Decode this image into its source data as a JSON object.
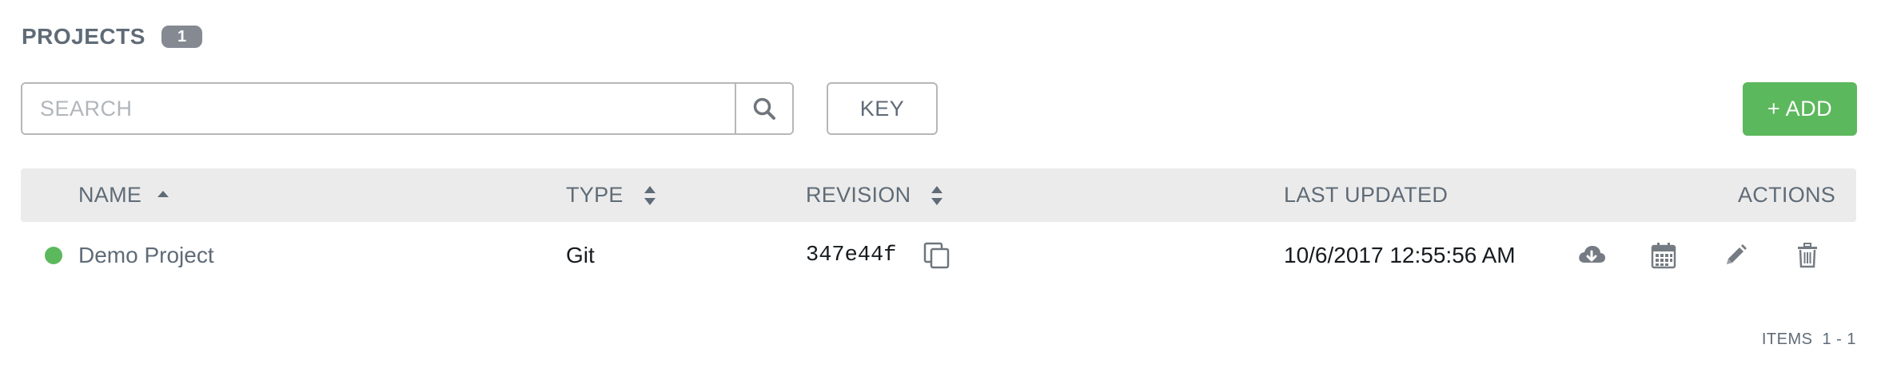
{
  "header": {
    "title": "PROJECTS",
    "count": "1"
  },
  "toolbar": {
    "search_placeholder": "SEARCH",
    "search_icon": "search-icon",
    "key_label": "KEY",
    "add_label": "+ ADD",
    "add_color": "#5cb85c"
  },
  "table": {
    "columns": [
      {
        "label": "NAME",
        "sort": "sort-up-icon"
      },
      {
        "label": "TYPE",
        "sort": "sort-both-icon"
      },
      {
        "label": "REVISION",
        "sort": "sort-both-icon"
      },
      {
        "label": "LAST UPDATED",
        "sort": null
      },
      {
        "label": "ACTIONS",
        "sort": null
      }
    ],
    "rows": [
      {
        "status": "success",
        "status_color": "#5cb85c",
        "name": "Demo Project",
        "type": "Git",
        "revision": "347e44f",
        "last_updated": "10/6/2017 12:55:56 AM",
        "actions": [
          "cloud-download-icon",
          "calendar-icon",
          "pencil-icon",
          "trash-icon"
        ]
      }
    ]
  },
  "pager": {
    "label": "ITEMS",
    "range": "1 - 1"
  }
}
